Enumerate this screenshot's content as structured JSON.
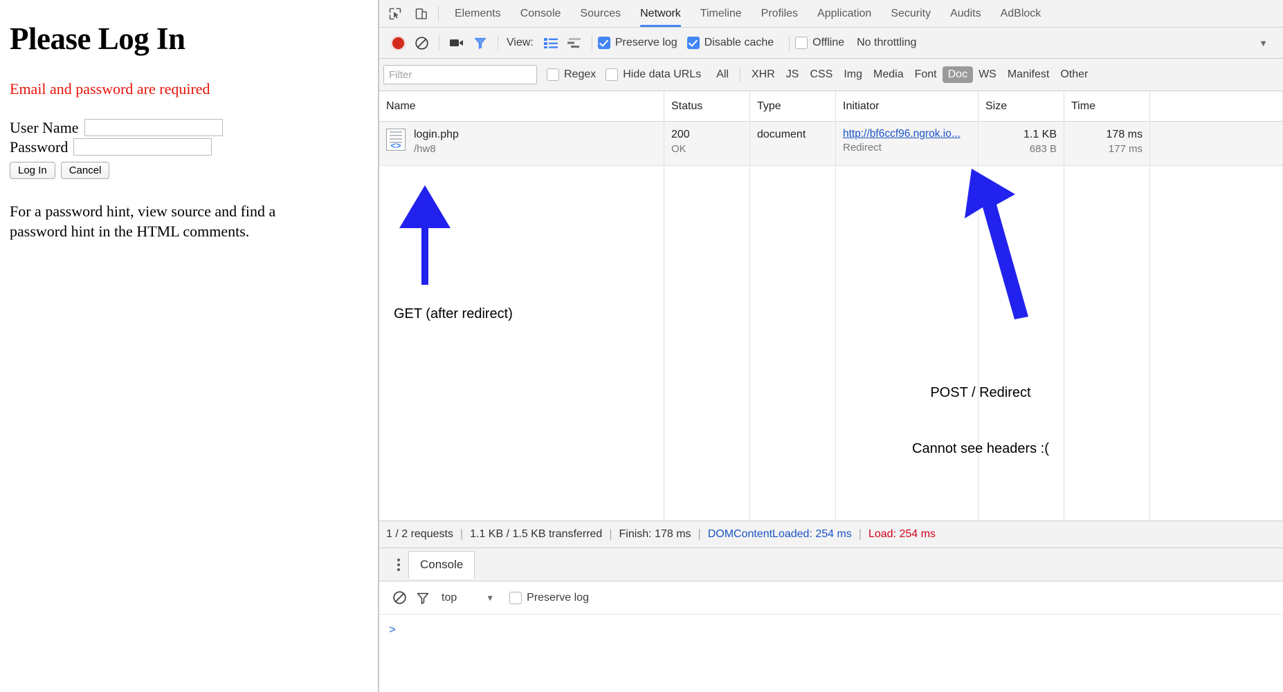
{
  "page": {
    "title": "Please Log In",
    "error": "Email and password are required",
    "username_label": "User Name",
    "password_label": "Password",
    "username_value": "",
    "password_value": "",
    "login_button": "Log In",
    "cancel_button": "Cancel",
    "hint": "For a password hint, view source and find a password hint in the HTML comments."
  },
  "devtools": {
    "tabs": [
      {
        "label": "Elements",
        "active": false
      },
      {
        "label": "Console",
        "active": false
      },
      {
        "label": "Sources",
        "active": false
      },
      {
        "label": "Network",
        "active": true
      },
      {
        "label": "Timeline",
        "active": false
      },
      {
        "label": "Profiles",
        "active": false
      },
      {
        "label": "Application",
        "active": false
      },
      {
        "label": "Security",
        "active": false
      },
      {
        "label": "Audits",
        "active": false
      },
      {
        "label": "AdBlock",
        "active": false
      }
    ],
    "controls": {
      "record_icon": "record-icon",
      "clear_icon": "clear-icon",
      "capture_screenshots_icon": "camera-icon",
      "filter_icon": "funnel-icon",
      "view_label": "View:",
      "view_list_icon": "list-view-icon",
      "view_waterfall_icon": "waterfall-view-icon",
      "preserve_log": "Preserve log",
      "preserve_log_checked": true,
      "disable_cache": "Disable cache",
      "disable_cache_checked": true,
      "offline": "Offline",
      "offline_checked": false,
      "throttling": "No throttling",
      "overflow_icon": "chevron-down-icon"
    },
    "filterbar": {
      "placeholder": "Filter",
      "value": "",
      "regex": "Regex",
      "regex_checked": false,
      "hide_data_urls": "Hide data URLs",
      "hide_data_urls_checked": false,
      "types": [
        "All",
        "XHR",
        "JS",
        "CSS",
        "Img",
        "Media",
        "Font",
        "Doc",
        "WS",
        "Manifest",
        "Other"
      ],
      "selected_type": "Doc"
    },
    "table": {
      "columns": [
        "Name",
        "Status",
        "Type",
        "Initiator",
        "Size",
        "Time"
      ],
      "rows": [
        {
          "name": "login.php",
          "name_sub": "/hw8",
          "status": "200",
          "status_sub": "OK",
          "type": "document",
          "type_sub": "",
          "initiator": "http://bf6ccf96.ngrok.io...",
          "initiator_sub": "Redirect",
          "size": "1.1 KB",
          "size_sub": "683 B",
          "time": "178 ms",
          "time_sub": "177 ms",
          "icon": "document-icon"
        }
      ]
    },
    "summary": {
      "requests": "1 / 2 requests",
      "transferred": "1.1 KB / 1.5 KB transferred",
      "finish": "Finish: 178 ms",
      "dom_content_loaded": "DOMContentLoaded: 254 ms",
      "load": "Load: 254 ms",
      "separator": "|"
    },
    "drawer": {
      "tab": "Console",
      "clear_icon": "clear-icon",
      "filter_icon": "funnel-icon",
      "context": "top",
      "context_caret": "chevron-down-icon",
      "preserve_log": "Preserve log",
      "preserve_log_checked": false,
      "prompt": ">",
      "input_value": ""
    }
  },
  "annotations": {
    "arrow_color": "#2222ee",
    "left_caption": "GET (after redirect)",
    "right_caption_line1": "POST / Redirect",
    "right_caption_line2": "Cannot see headers :("
  }
}
